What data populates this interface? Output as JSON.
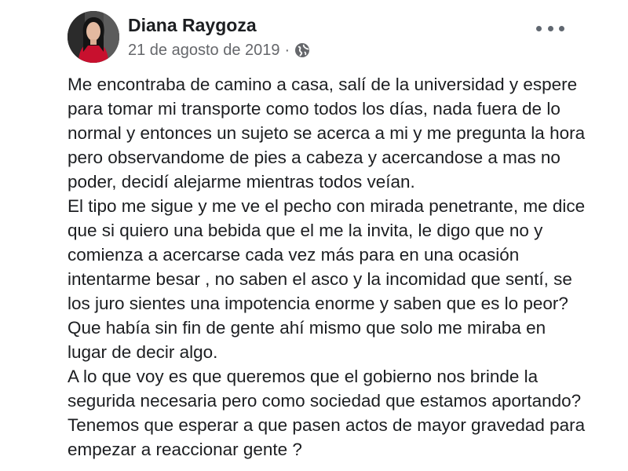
{
  "post": {
    "author": "Diana Raygoza",
    "date": "21 de agosto de 2019",
    "separator": "·",
    "privacy_icon": "globe-icon",
    "menu_icon": "more-options-icon",
    "paragraphs": [
      "Me encontraba de camino a casa, salí de la universidad y espere para tomar mi transporte como todos los días, nada fuera de lo normal y entonces un sujeto se acerca a mi y me pregunta la hora pero observandome de pies a cabeza y acercandose a mas no poder, decidí alejarme mientras todos veían.",
      "El tipo me sigue y me ve el pecho con mirada penetrante, me dice que si quiero una bebida que el me la invita, le digo que no y comienza a acercarse cada vez más para en una ocasión intentarme besar , no saben el asco y la incomidad que sentí, se los juro sientes una impotencia enorme y saben que es lo peor? Que había sin fin de gente ahí mismo que solo me miraba en lugar de decir algo.",
      "A lo que voy es que queremos que el gobierno nos brinde la segurida necesaria pero como sociedad que estamos aportando? Tenemos que esperar a que pasen actos de mayor gravedad para empezar a reaccionar gente ?"
    ]
  }
}
